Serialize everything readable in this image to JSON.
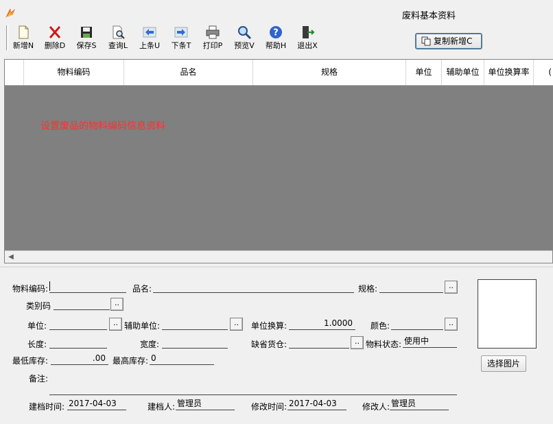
{
  "window": {
    "title": "废料基本资料"
  },
  "toolbar": {
    "items": [
      {
        "label": "新增N",
        "icon": "new-document-icon"
      },
      {
        "label": "删除D",
        "icon": "delete-x-icon"
      },
      {
        "label": "保存S",
        "icon": "floppy-save-icon"
      },
      {
        "label": "查询L",
        "icon": "search-document-icon"
      },
      {
        "label": "上条U",
        "icon": "arrow-left-icon"
      },
      {
        "label": "下条T",
        "icon": "arrow-right-icon"
      },
      {
        "label": "打印P",
        "icon": "printer-icon"
      },
      {
        "label": "预览V",
        "icon": "magnifier-icon"
      },
      {
        "label": "帮助H",
        "icon": "help-icon"
      },
      {
        "label": "退出X",
        "icon": "exit-door-icon"
      }
    ],
    "copy_new_label": "复制新增C"
  },
  "grid": {
    "columns": [
      "物料编码",
      "品名",
      "规格",
      "单位",
      "辅助单位",
      "单位换算率",
      "("
    ],
    "rows": [],
    "hint": "设置废品的物料编码信息资料"
  },
  "form": {
    "material_code": {
      "label": "物料编码:",
      "value": ""
    },
    "product_name": {
      "label": "品名:",
      "value": ""
    },
    "spec": {
      "label": "规格:",
      "value": ""
    },
    "category_code": {
      "label": "类别码",
      "value": ""
    },
    "unit": {
      "label": "单位:",
      "value": ""
    },
    "aux_unit": {
      "label": "辅助单位:",
      "value": ""
    },
    "unit_conversion": {
      "label": "单位换算:",
      "value": "1.0000"
    },
    "color": {
      "label": "颜色:",
      "value": ""
    },
    "length": {
      "label": "长度:",
      "value": ""
    },
    "width": {
      "label": "宽度:",
      "value": ""
    },
    "default_warehouse": {
      "label": "缺省货仓:",
      "value": ""
    },
    "material_status": {
      "label": "物料状态:",
      "value": "使用中"
    },
    "min_stock": {
      "label": "最低库存:",
      "value": ".00"
    },
    "max_stock": {
      "label": "最高库存:",
      "value": "0"
    },
    "remarks": {
      "label": "备注:",
      "value": ""
    },
    "created_time": {
      "label": "建档时间:",
      "value": "2017-04-03"
    },
    "creator": {
      "label": "建档人:",
      "value": "管理员"
    },
    "modified_time": {
      "label": "修改时间:",
      "value": "2017-04-03"
    },
    "modifier": {
      "label": "修改人:",
      "value": "管理员"
    },
    "browse_label": "..",
    "pick_image_label": "选择图片"
  }
}
